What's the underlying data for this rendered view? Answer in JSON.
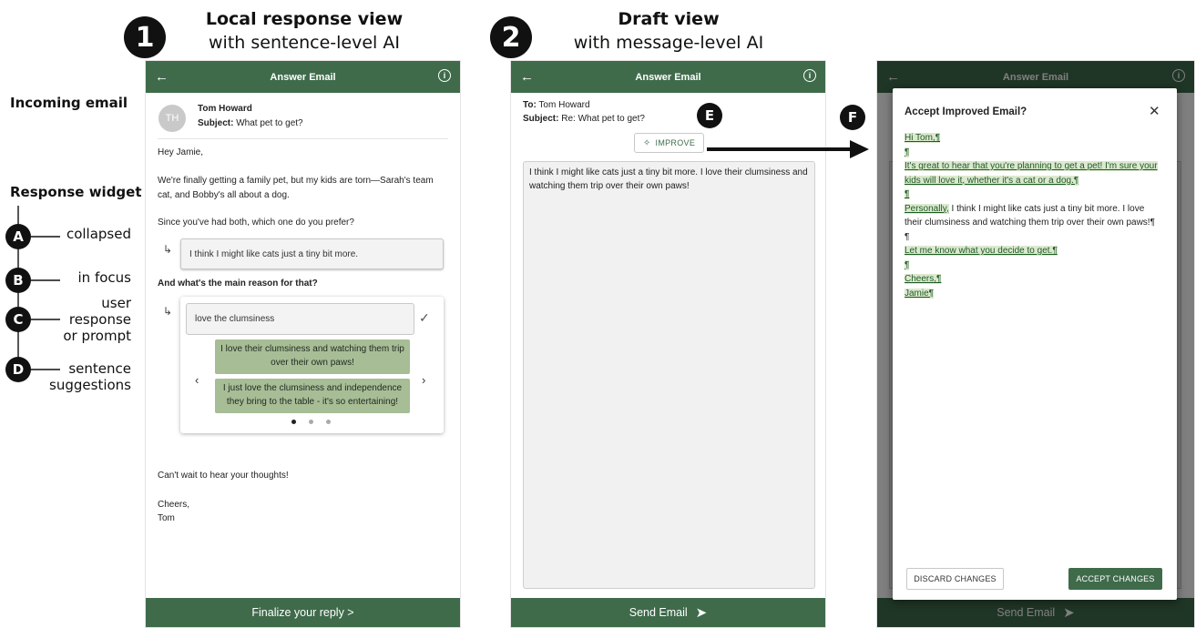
{
  "panel1": {
    "badge": "1",
    "heading_title": "Local response view",
    "heading_sub": "with sentence-level AI",
    "appbar_title": "Answer Email",
    "avatar_initials": "TH",
    "sender": "Tom Howard",
    "subject_label": "Subject:",
    "subject": "What pet to get?",
    "greeting": "Hey Jamie,",
    "para1_line1": "We're finally getting a family pet, but my kids are torn—Sarah's team",
    "para1_line2": "cat, and Bobby's all about a dog.",
    "question1": "Since you've had both, which one do you prefer?",
    "response1": "I think I might like cats just a tiny bit more.",
    "question2": "And what's the main reason for that?",
    "prompt_input": "love the clumsiness",
    "suggestion1": "I love their clumsiness and watching them trip over their own paws!",
    "suggestion2": "I just love the clumsiness and independence they bring to the table - it's so entertaining!",
    "closing_line": "Can't wait to hear your thoughts!",
    "signoff": "Cheers,",
    "signature": "Tom",
    "bottom_label": "Finalize your reply >"
  },
  "panel2": {
    "badge": "2",
    "heading_title": "Draft view",
    "heading_sub": "with message-level AI",
    "appbar_title": "Answer Email",
    "to_label": "To:",
    "to": "Tom Howard",
    "subject_label": "Subject:",
    "subject": "Re: What pet to get?",
    "improve_label": "IMPROVE",
    "draft_text": "I think I might like cats just a tiny bit more. I love their clumsiness and watching them trip over their own paws!",
    "bottom_label": "Send Email"
  },
  "panel3": {
    "appbar_title": "Answer Email",
    "dialog_title": "Accept Improved Email?",
    "lines": {
      "l1": "Hi Tom,¶",
      "pm": "¶",
      "l3a": "It's great to hear that you're planning to get a pet! I'm sure your",
      "l3b": "kids will love it, whether it's a cat or a dog.¶",
      "l5_hl": "Personally,",
      "l5_rest": " I think I might like cats just a tiny bit more. I love",
      "l5b": "their clumsiness and watching them trip over their own paws!¶",
      "l7": "Let me know what you decide to get.¶",
      "l9": "Cheers,¶",
      "l10": "Jamie¶"
    },
    "discard_label": "DISCARD CHANGES",
    "accept_label": "ACCEPT CHANGES",
    "bottom_label": "Send Email"
  },
  "side": {
    "incoming_email": "Incoming email",
    "response_widget": "Response widget",
    "a_badge": "A",
    "a_label": "collapsed",
    "b_badge": "B",
    "b_label": "in focus",
    "c_badge": "C",
    "c_label_1": "user",
    "c_label_2": "response",
    "c_label_3": "or prompt",
    "d_badge": "D",
    "d_label_1": "sentence",
    "d_label_2": "suggestions"
  },
  "markers": {
    "e": "E",
    "f": "F"
  },
  "colors": {
    "app_green": "#3f6b4b",
    "suggestion_green": "#a7bd96",
    "highlight_green": "#dce8d0"
  }
}
